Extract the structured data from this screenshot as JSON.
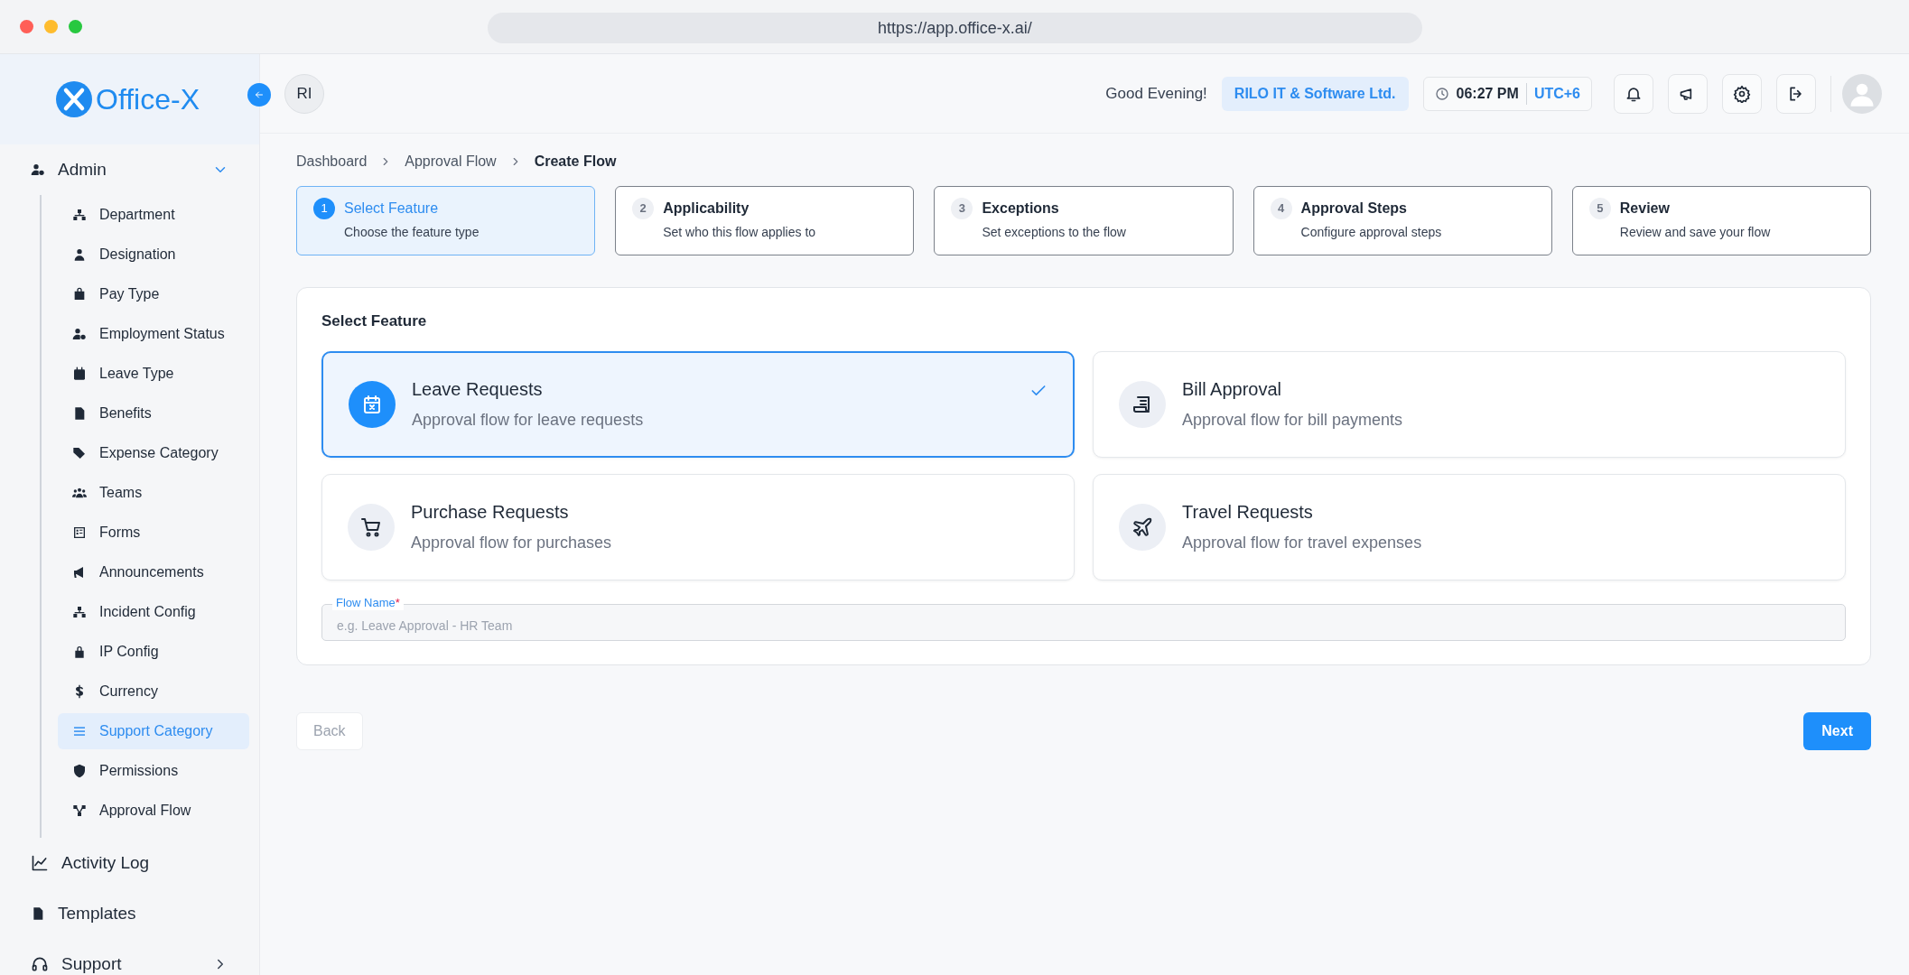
{
  "browser": {
    "url": "https://app.office-x.ai/"
  },
  "sidebar": {
    "logo": "Office-X",
    "items": [
      {
        "label": "Admin",
        "kind": "group",
        "expanded": true,
        "children": [
          {
            "label": "Department",
            "selected": false
          },
          {
            "label": "Designation",
            "selected": false
          },
          {
            "label": "Pay Type",
            "selected": false
          },
          {
            "label": "Employment Status",
            "selected": false
          },
          {
            "label": "Leave Type",
            "selected": false
          },
          {
            "label": "Benefits",
            "selected": false
          },
          {
            "label": "Expense Category",
            "selected": false
          },
          {
            "label": "Teams",
            "selected": false
          },
          {
            "label": "Forms",
            "selected": false
          },
          {
            "label": "Announcements",
            "selected": false
          },
          {
            "label": "Incident Config",
            "selected": false
          },
          {
            "label": "IP Config",
            "selected": false
          },
          {
            "label": "Currency",
            "selected": false
          },
          {
            "label": "Support Category",
            "selected": true
          },
          {
            "label": "Permissions",
            "selected": false
          },
          {
            "label": "Approval Flow",
            "selected": false
          }
        ]
      },
      {
        "label": "Activity Log",
        "kind": "link"
      },
      {
        "label": "Templates",
        "kind": "link"
      },
      {
        "label": "Support",
        "kind": "group",
        "expanded": false
      }
    ]
  },
  "header": {
    "user_initials": "RI",
    "greeting": "Good Evening!",
    "company": "RILO IT & Software Ltd.",
    "time": "06:27 PM",
    "timezone": "UTC+6"
  },
  "breadcrumb": [
    {
      "label": "Dashboard",
      "current": false
    },
    {
      "label": "Approval Flow",
      "current": false
    },
    {
      "label": "Create Flow",
      "current": true
    }
  ],
  "steps": [
    {
      "number": "1",
      "title": "Select Feature",
      "subtitle": "Choose the feature type",
      "selected": true
    },
    {
      "number": "2",
      "title": "Applicability",
      "subtitle": "Set who this flow applies to",
      "selected": false
    },
    {
      "number": "3",
      "title": "Exceptions",
      "subtitle": "Set exceptions to the flow",
      "selected": false
    },
    {
      "number": "4",
      "title": "Approval Steps",
      "subtitle": "Configure approval steps",
      "selected": false
    },
    {
      "number": "5",
      "title": "Review",
      "subtitle": "Review and save your flow",
      "selected": false
    }
  ],
  "feature_section": {
    "title": "Select Feature",
    "options": [
      {
        "title": "Leave Requests",
        "description": "Approval flow for leave requests",
        "selected": true
      },
      {
        "title": "Bill Approval",
        "description": "Approval flow for bill payments",
        "selected": false
      },
      {
        "title": "Purchase Requests",
        "description": "Approval flow for purchases",
        "selected": false
      },
      {
        "title": "Travel Requests",
        "description": "Approval flow for travel expenses",
        "selected": false
      }
    ],
    "flow_name": {
      "label": "Flow Name",
      "required_mark": "*",
      "placeholder": "e.g. Leave Approval - HR Team"
    }
  },
  "buttons": {
    "back": {
      "label": "Back",
      "disabled": true
    },
    "next": {
      "label": "Next",
      "disabled": false
    }
  }
}
